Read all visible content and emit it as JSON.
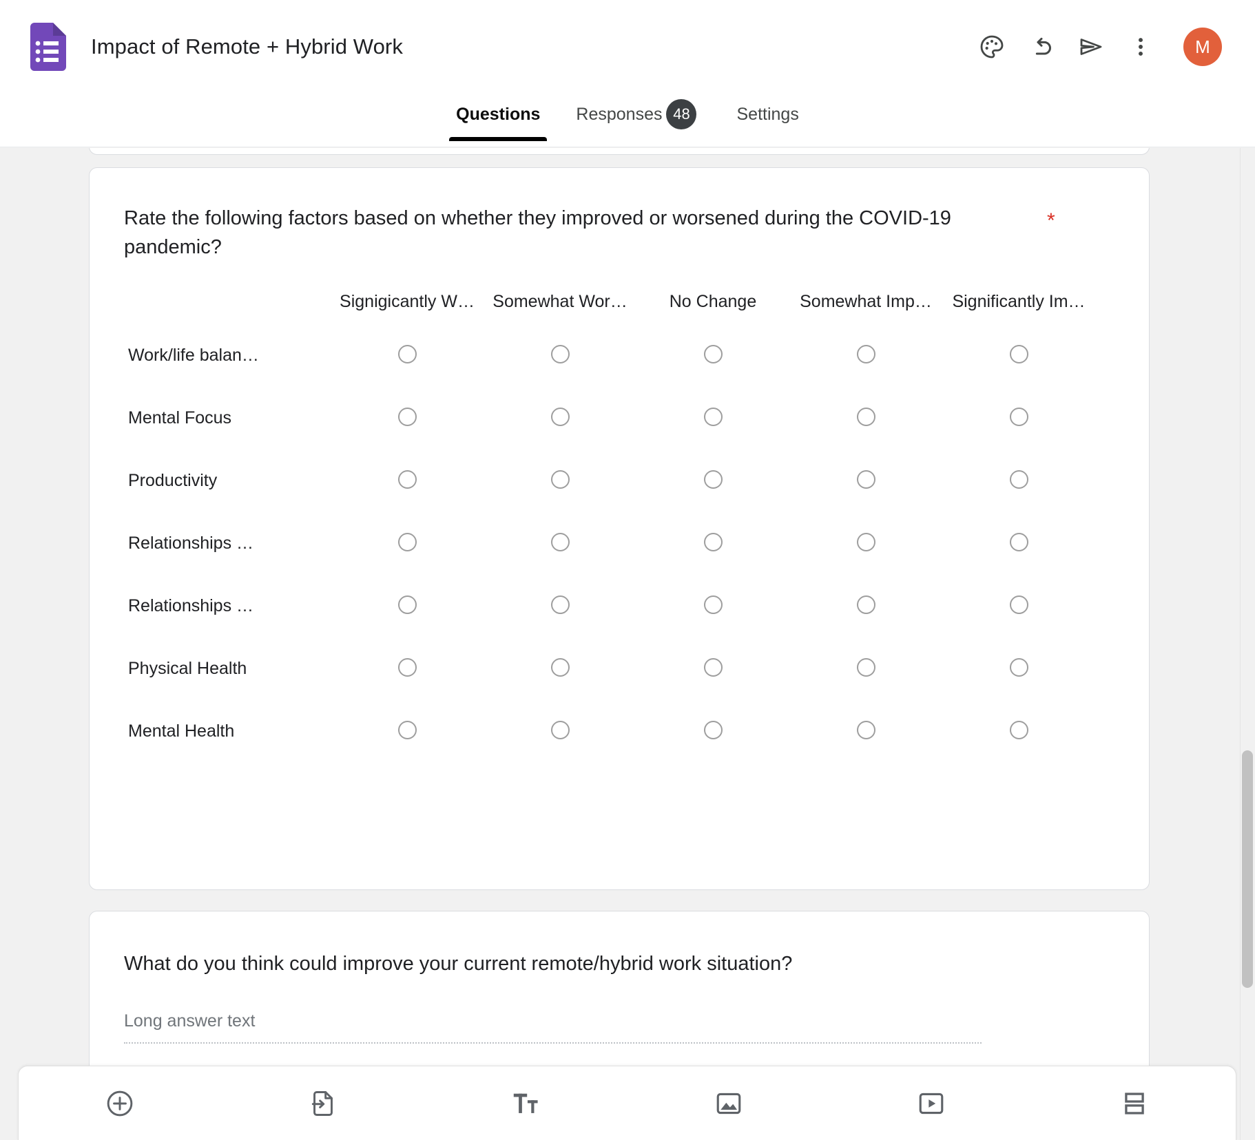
{
  "app": {
    "icon_name": "google-forms-icon",
    "icon_color": "#7248b9",
    "title": "Impact of Remote + Hybrid Work"
  },
  "header": {
    "actions": [
      {
        "name": "palette-icon",
        "label": "Customize theme"
      },
      {
        "name": "undo-icon",
        "label": "Undo"
      },
      {
        "name": "send-icon",
        "label": "Send"
      },
      {
        "name": "more-vert-icon",
        "label": "More options"
      }
    ],
    "avatar_initial": "M",
    "avatar_color": "#e2603b"
  },
  "tabs": [
    {
      "label": "Questions",
      "active": true,
      "badge": null
    },
    {
      "label": "Responses",
      "active": false,
      "badge": "48"
    },
    {
      "label": "Settings",
      "active": false,
      "badge": null
    }
  ],
  "questions": [
    {
      "type": "multiple-choice-grid",
      "title": "Rate the following factors based on whether they improved or worsened during the COVID-19 pandemic?",
      "required": true,
      "required_marker": "*",
      "columns": [
        "Signigicantly W…",
        "Somewhat Wor…",
        "No Change",
        "Somewhat Imp…",
        "Significantly Im…"
      ],
      "rows": [
        "Work/life balan…",
        "Mental Focus",
        "Productivity",
        "Relationships …",
        "Relationships …",
        "Physical Health",
        "Mental Health"
      ]
    },
    {
      "type": "long-answer",
      "title": "What do you think could improve your current remote/hybrid work situation?",
      "required": false,
      "placeholder": "Long answer text"
    }
  ],
  "bottom_toolbar": [
    {
      "name": "add-question-icon",
      "label": "Add question"
    },
    {
      "name": "import-questions-icon",
      "label": "Import questions"
    },
    {
      "name": "add-title-description-icon",
      "label": "Add title and description"
    },
    {
      "name": "add-image-icon",
      "label": "Add image"
    },
    {
      "name": "add-video-icon",
      "label": "Add video"
    },
    {
      "name": "add-section-icon",
      "label": "Add section"
    }
  ],
  "colors": {
    "page_background": "#f1f1f1",
    "card_background": "#ffffff",
    "card_border": "#dadce0",
    "text_primary": "#202124",
    "required_red": "#d93025",
    "radio_border": "#9e9e9e",
    "badge_background": "#3c4043"
  }
}
